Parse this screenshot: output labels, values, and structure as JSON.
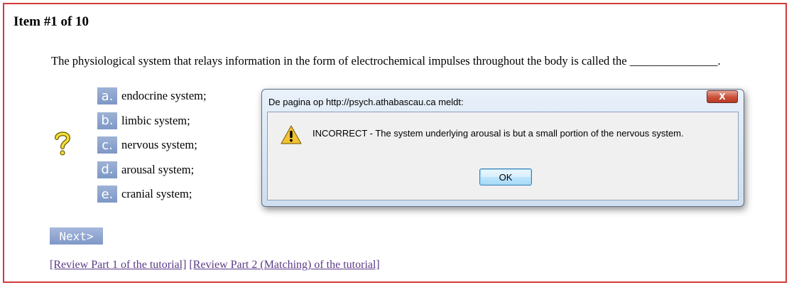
{
  "page": {
    "item_title": "Item #1 of 10",
    "question": "The physiological system that relays information in the form of electrochemical impulses throughout the body is called the _______________.",
    "help_icon": "question-mark-icon",
    "options": [
      {
        "letter": "a.",
        "text": "endocrine system;"
      },
      {
        "letter": "b.",
        "text": "limbic system;"
      },
      {
        "letter": "c.",
        "text": "nervous system;"
      },
      {
        "letter": "d.",
        "text": "arousal system;"
      },
      {
        "letter": "e.",
        "text": "cranial system;"
      }
    ],
    "next_label": "Next>",
    "links": {
      "review1": "[Review Part 1 of the tutorial]",
      "review2": "[Review Part 2 (Matching) of the tutorial]"
    }
  },
  "dialog": {
    "title": "De pagina op http://psych.athabascau.ca meldt:",
    "close_label": "X",
    "icon": "warning-icon",
    "message": "INCORRECT - The system underlying arousal is but a small portion of the nervous system.",
    "ok_label": "OK"
  },
  "colors": {
    "frame_border": "#d23a3a",
    "option_badge": "#8aa2cf",
    "link": "#5a3a87"
  }
}
